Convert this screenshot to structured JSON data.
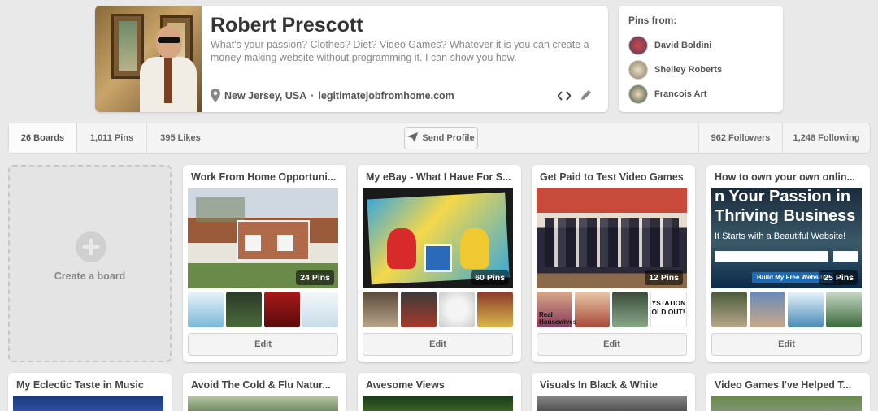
{
  "profile": {
    "name": "Robert Prescott",
    "bio": "What's your passion? Clothes? Diet? Video Games? Whatever it is you can create a money making website without programming it. I can show you how.",
    "location": "New Jersey, USA",
    "separator": " · ",
    "website": "legitimatejobfromhome.com"
  },
  "pins_from": {
    "heading": "Pins from:",
    "people": [
      {
        "name": "David Boldini"
      },
      {
        "name": "Shelley Roberts"
      },
      {
        "name": "Francois Art"
      }
    ]
  },
  "stats": {
    "boards": "26 Boards",
    "pins": "1,011 Pins",
    "likes": "395 Likes",
    "send_profile": "Send Profile",
    "followers": "962 Followers",
    "following": "1,248 Following"
  },
  "create_board": {
    "label": "Create a board"
  },
  "boards": [
    {
      "title": "Work From Home Opportuni...",
      "pin_count": "24 Pins",
      "edit": "Edit"
    },
    {
      "title": "My eBay - What I Have For S...",
      "pin_count": "60 Pins",
      "edit": "Edit"
    },
    {
      "title": "Get Paid to Test Video Games",
      "pin_count": "12 Pins",
      "edit": "Edit"
    },
    {
      "title": "How to own your own onlin...",
      "pin_count": "25 Pins",
      "edit": "Edit",
      "cover_lines": [
        "n Your Passion in",
        "Thriving Business",
        "It Starts with a Beautiful Website!",
        "Build My Free Website!"
      ],
      "thumb_texts": []
    },
    {
      "title": "My Eclectic Taste in Music"
    },
    {
      "title": "Avoid The Cold & Flu Natur..."
    },
    {
      "title": "Awesome Views"
    },
    {
      "title": "Visuals In Black & White"
    },
    {
      "title": "Video Games I've Helped T..."
    }
  ],
  "thumb_texts": {
    "board3_last": [
      "YSTATION",
      "OLD OUT!"
    ],
    "board3_first": [
      "Real",
      "Housewives"
    ]
  },
  "icons": {
    "location": "map-pin-icon",
    "embed": "code-icon",
    "edit": "pencil-icon",
    "send": "paper-plane-icon",
    "plus": "plus-icon"
  }
}
